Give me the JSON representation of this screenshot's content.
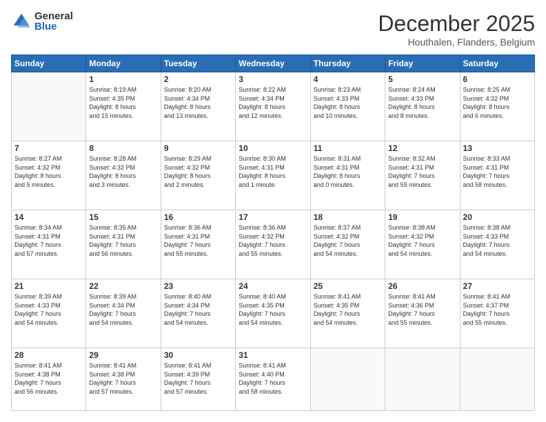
{
  "logo": {
    "general": "General",
    "blue": "Blue"
  },
  "header": {
    "month": "December 2025",
    "location": "Houthalen, Flanders, Belgium"
  },
  "weekdays": [
    "Sunday",
    "Monday",
    "Tuesday",
    "Wednesday",
    "Thursday",
    "Friday",
    "Saturday"
  ],
  "weeks": [
    [
      {
        "day": "",
        "info": ""
      },
      {
        "day": "1",
        "info": "Sunrise: 8:19 AM\nSunset: 4:35 PM\nDaylight: 8 hours\nand 15 minutes."
      },
      {
        "day": "2",
        "info": "Sunrise: 8:20 AM\nSunset: 4:34 PM\nDaylight: 8 hours\nand 13 minutes."
      },
      {
        "day": "3",
        "info": "Sunrise: 8:22 AM\nSunset: 4:34 PM\nDaylight: 8 hours\nand 12 minutes."
      },
      {
        "day": "4",
        "info": "Sunrise: 8:23 AM\nSunset: 4:33 PM\nDaylight: 8 hours\nand 10 minutes."
      },
      {
        "day": "5",
        "info": "Sunrise: 8:24 AM\nSunset: 4:33 PM\nDaylight: 8 hours\nand 8 minutes."
      },
      {
        "day": "6",
        "info": "Sunrise: 8:25 AM\nSunset: 4:32 PM\nDaylight: 8 hours\nand 6 minutes."
      }
    ],
    [
      {
        "day": "7",
        "info": "Sunrise: 8:27 AM\nSunset: 4:32 PM\nDaylight: 8 hours\nand 5 minutes."
      },
      {
        "day": "8",
        "info": "Sunrise: 8:28 AM\nSunset: 4:32 PM\nDaylight: 8 hours\nand 3 minutes."
      },
      {
        "day": "9",
        "info": "Sunrise: 8:29 AM\nSunset: 4:32 PM\nDaylight: 8 hours\nand 2 minutes."
      },
      {
        "day": "10",
        "info": "Sunrise: 8:30 AM\nSunset: 4:31 PM\nDaylight: 8 hours\nand 1 minute."
      },
      {
        "day": "11",
        "info": "Sunrise: 8:31 AM\nSunset: 4:31 PM\nDaylight: 8 hours\nand 0 minutes."
      },
      {
        "day": "12",
        "info": "Sunrise: 8:32 AM\nSunset: 4:31 PM\nDaylight: 7 hours\nand 59 minutes."
      },
      {
        "day": "13",
        "info": "Sunrise: 8:33 AM\nSunset: 4:31 PM\nDaylight: 7 hours\nand 58 minutes."
      }
    ],
    [
      {
        "day": "14",
        "info": "Sunrise: 8:34 AM\nSunset: 4:31 PM\nDaylight: 7 hours\nand 57 minutes."
      },
      {
        "day": "15",
        "info": "Sunrise: 8:35 AM\nSunset: 4:31 PM\nDaylight: 7 hours\nand 56 minutes."
      },
      {
        "day": "16",
        "info": "Sunrise: 8:36 AM\nSunset: 4:31 PM\nDaylight: 7 hours\nand 55 minutes."
      },
      {
        "day": "17",
        "info": "Sunrise: 8:36 AM\nSunset: 4:32 PM\nDaylight: 7 hours\nand 55 minutes."
      },
      {
        "day": "18",
        "info": "Sunrise: 8:37 AM\nSunset: 4:32 PM\nDaylight: 7 hours\nand 54 minutes."
      },
      {
        "day": "19",
        "info": "Sunrise: 8:38 AM\nSunset: 4:32 PM\nDaylight: 7 hours\nand 54 minutes."
      },
      {
        "day": "20",
        "info": "Sunrise: 8:38 AM\nSunset: 4:33 PM\nDaylight: 7 hours\nand 54 minutes."
      }
    ],
    [
      {
        "day": "21",
        "info": "Sunrise: 8:39 AM\nSunset: 4:33 PM\nDaylight: 7 hours\nand 54 minutes."
      },
      {
        "day": "22",
        "info": "Sunrise: 8:39 AM\nSunset: 4:34 PM\nDaylight: 7 hours\nand 54 minutes."
      },
      {
        "day": "23",
        "info": "Sunrise: 8:40 AM\nSunset: 4:34 PM\nDaylight: 7 hours\nand 54 minutes."
      },
      {
        "day": "24",
        "info": "Sunrise: 8:40 AM\nSunset: 4:35 PM\nDaylight: 7 hours\nand 54 minutes."
      },
      {
        "day": "25",
        "info": "Sunrise: 8:41 AM\nSunset: 4:35 PM\nDaylight: 7 hours\nand 54 minutes."
      },
      {
        "day": "26",
        "info": "Sunrise: 8:41 AM\nSunset: 4:36 PM\nDaylight: 7 hours\nand 55 minutes."
      },
      {
        "day": "27",
        "info": "Sunrise: 8:41 AM\nSunset: 4:37 PM\nDaylight: 7 hours\nand 55 minutes."
      }
    ],
    [
      {
        "day": "28",
        "info": "Sunrise: 8:41 AM\nSunset: 4:38 PM\nDaylight: 7 hours\nand 56 minutes."
      },
      {
        "day": "29",
        "info": "Sunrise: 8:41 AM\nSunset: 4:38 PM\nDaylight: 7 hours\nand 57 minutes."
      },
      {
        "day": "30",
        "info": "Sunrise: 8:41 AM\nSunset: 4:39 PM\nDaylight: 7 hours\nand 57 minutes."
      },
      {
        "day": "31",
        "info": "Sunrise: 8:41 AM\nSunset: 4:40 PM\nDaylight: 7 hours\nand 58 minutes."
      },
      {
        "day": "",
        "info": ""
      },
      {
        "day": "",
        "info": ""
      },
      {
        "day": "",
        "info": ""
      }
    ]
  ]
}
